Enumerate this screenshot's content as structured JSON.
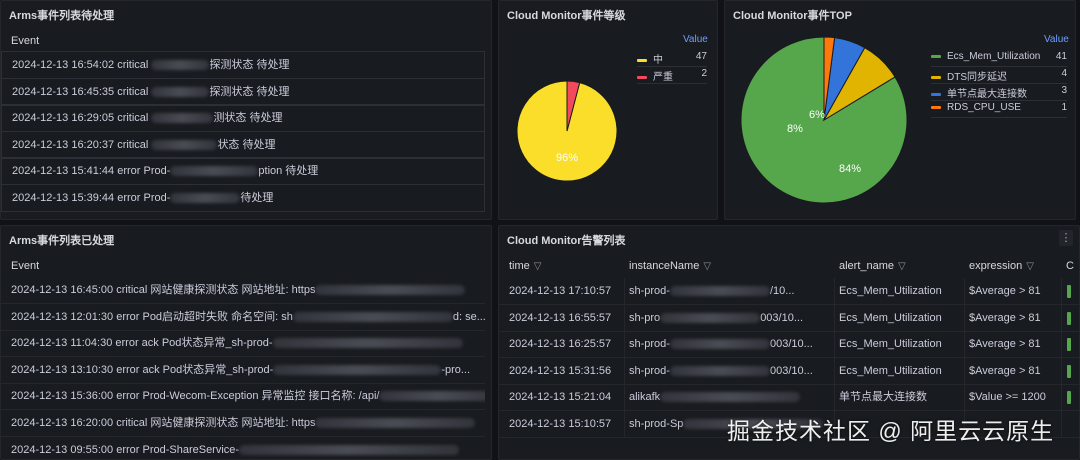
{
  "arms_pending": {
    "title": "Arms事件列表待处理",
    "col_header": "Event",
    "rows": [
      {
        "pre": "2024-12-13 16:54:02 critical ",
        "post": "探测状态 待处理"
      },
      {
        "pre": "2024-12-13 16:45:35 critical ",
        "post": "探测状态 待处理"
      },
      {
        "pre": "2024-12-13 16:29:05 critical ",
        "post": "测状态 待处理"
      },
      {
        "pre": "2024-12-13 16:20:37 critical ",
        "post": "状态 待处理"
      },
      {
        "pre": "2024-12-13 15:41:44 error Prod-",
        "post": "ption 待处理"
      },
      {
        "pre": "2024-12-13 15:39:44 error Prod-",
        "post": "待处理"
      }
    ]
  },
  "cm_level": {
    "title": "Cloud Monitor事件等级",
    "legend_header": "Value",
    "items": [
      {
        "name": "中",
        "value": "47",
        "color": "#fade2a"
      },
      {
        "name": "严重",
        "value": "2",
        "color": "#f2495c"
      }
    ],
    "pie_label": "96%"
  },
  "cm_top": {
    "title": "Cloud Monitor事件TOP",
    "legend_header": "Value",
    "items": [
      {
        "name": "Ecs_Mem_Utilization",
        "value": "41",
        "color": "#56a64b"
      },
      {
        "name": "DTS同步延迟",
        "value": "4",
        "color": "#e0b400"
      },
      {
        "name": "单节点最大连接数",
        "value": "3",
        "color": "#3274d9"
      },
      {
        "name": "RDS_CPU_USE",
        "value": "1",
        "color": "#ff780a"
      }
    ],
    "pie_labels": [
      "84%",
      "8%",
      "6%"
    ]
  },
  "arms_done": {
    "title": "Arms事件列表已处理",
    "col_header": "Event",
    "rows": [
      {
        "pre": "2024-12-13 16:45:00 critical 网站健康探测状态 网站地址: https",
        "post": ""
      },
      {
        "pre": "2024-12-13 12:01:30 error Pod启动超时失败 命名空间: sh",
        "post": "d: se..."
      },
      {
        "pre": "2024-12-13 11:04:30 error ack Pod状态异常_sh-prod-",
        "post": ""
      },
      {
        "pre": "2024-12-13 13:10:30 error ack Pod状态异常_sh-prod-",
        "post": "-pro..."
      },
      {
        "pre": "2024-12-13 15:36:00 error Prod-Wecom-Exception 异常监控 接口名称: /api/",
        "post": ""
      },
      {
        "pre": "2024-12-13 16:20:00 critical 网站健康探测状态 网站地址: https",
        "post": ""
      },
      {
        "pre": "2024-12-13 09:55:00 error Prod-ShareService-",
        "post": ""
      }
    ]
  },
  "cm_alerts": {
    "title": "Cloud Monitor告警列表",
    "menu_glyph": "⋮",
    "filter_glyph": "▽",
    "columns": [
      "time",
      "instanceName",
      "alert_name",
      "expression",
      "C"
    ],
    "rows": [
      {
        "time": "2024-12-13 17:10:57",
        "inst_pre": "sh-prod-",
        "inst_post": "/10...",
        "alert": "Ecs_Mem_Utilization",
        "expr": "$Average > 81"
      },
      {
        "time": "2024-12-13 16:55:57",
        "inst_pre": "sh-pro",
        "inst_post": "003/10...",
        "alert": "Ecs_Mem_Utilization",
        "expr": "$Average > 81"
      },
      {
        "time": "2024-12-13 16:25:57",
        "inst_pre": "sh-prod-",
        "inst_post": "003/10...",
        "alert": "Ecs_Mem_Utilization",
        "expr": "$Average > 81"
      },
      {
        "time": "2024-12-13 15:31:56",
        "inst_pre": "sh-prod-",
        "inst_post": "003/10...",
        "alert": "Ecs_Mem_Utilization",
        "expr": "$Average > 81"
      },
      {
        "time": "2024-12-13 15:21:04",
        "inst_pre": "alikafk",
        "inst_post": "",
        "alert": "单节点最大连接数",
        "expr": "$Value >= 1200"
      },
      {
        "time": "2024-12-13 15:10:57",
        "inst_pre": "sh-prod-Sp",
        "inst_post": "",
        "alert": "",
        "expr": ""
      }
    ]
  },
  "watermark": "掘金技术社区 @ 阿里云云原生"
}
